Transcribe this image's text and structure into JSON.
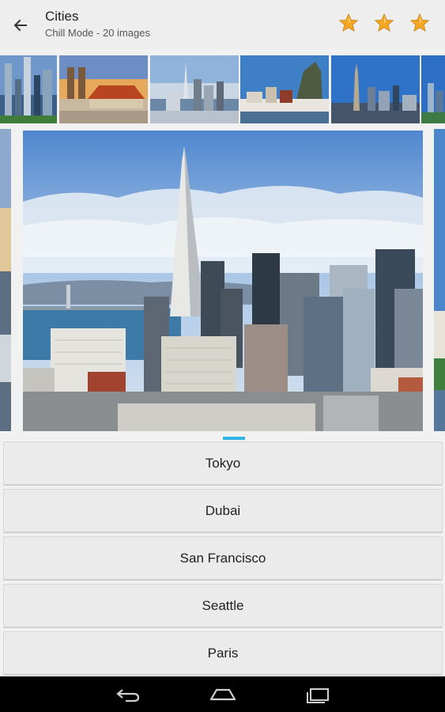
{
  "appbar": {
    "title": "Cities",
    "subtitle": "Chill Mode - 20 images",
    "back_icon": "arrow-left-icon",
    "stars": [
      {
        "icon": "star-icon",
        "color": "#f5a623"
      },
      {
        "icon": "star-icon",
        "color": "#f5a623"
      },
      {
        "icon": "star-icon",
        "color": "#f5a623"
      }
    ]
  },
  "thumbnails": [
    {
      "name": "thumb-skyline-dusk"
    },
    {
      "name": "thumb-old-town-church"
    },
    {
      "name": "thumb-bay-skyline"
    },
    {
      "name": "thumb-harbor-rock"
    },
    {
      "name": "thumb-tower-city"
    },
    {
      "name": "thumb-partial"
    }
  ],
  "main_image": {
    "name": "city-skyline-photo"
  },
  "pager": {
    "accent": "#33b5e5"
  },
  "answers": [
    {
      "label": "Tokyo"
    },
    {
      "label": "Dubai"
    },
    {
      "label": "San Francisco"
    },
    {
      "label": "Seattle"
    },
    {
      "label": "Paris"
    }
  ],
  "navbar": {
    "back_icon": "nav-back-icon",
    "home_icon": "nav-home-icon",
    "recents_icon": "nav-recents-icon"
  }
}
